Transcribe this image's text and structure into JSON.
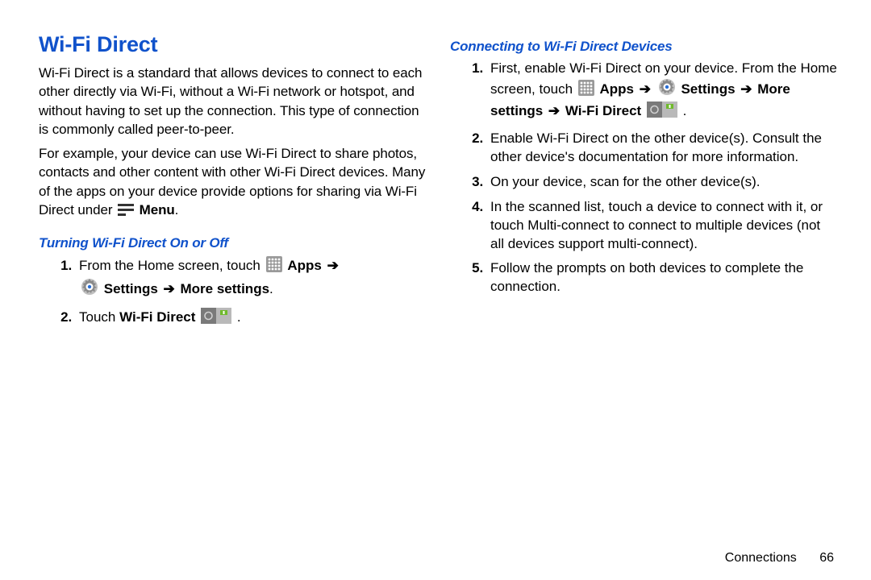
{
  "heading": "Wi-Fi Direct",
  "para1": "Wi-Fi Direct is a standard that allows devices to connect to each other directly via Wi-Fi, without a Wi-Fi network or hotspot, and without having to set up the connection. This type of connection is commonly called peer-to-peer.",
  "para2_pre": "For example, your device can use Wi-Fi Direct to share photos, contacts and other content with other Wi-Fi Direct devices. Many of the apps on your device provide options for sharing via Wi-Fi Direct under ",
  "para2_menu": "Menu",
  "subA": "Turning Wi-Fi Direct On or Off",
  "a1_pre": "From the Home screen, touch ",
  "a1_apps": "Apps",
  "a1_settings": "Settings",
  "a1_more": "More settings",
  "a2_pre": "Touch ",
  "a2_wfd": "Wi-Fi Direct",
  "subB": "Connecting to Wi-Fi Direct Devices",
  "b1_pre": "First, enable Wi-Fi Direct on your device. From the Home screen, touch ",
  "b1_apps": "Apps",
  "b1_settings": "Settings",
  "b1_more": "More settings",
  "b1_wfd": "Wi-Fi Direct",
  "b2": "Enable Wi-Fi Direct on the other device(s). Consult the other device's documentation for more information.",
  "b3": "On your device, scan for the other device(s).",
  "b4": "In the scanned list, touch a device to connect with it, or touch Multi-connect to connect to multiple devices (not all devices support multi-connect).",
  "b5": "Follow the prompts on both devices to complete the connection.",
  "footer_section": "Connections",
  "footer_page": "66",
  "arrow": "➔",
  "period": "."
}
